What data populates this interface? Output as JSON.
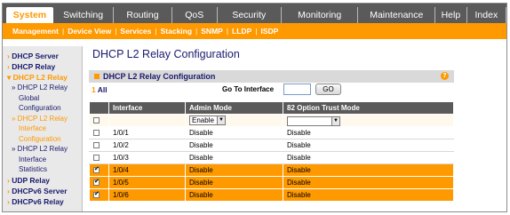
{
  "top_tabs": [
    "System",
    "Switching",
    "Routing",
    "QoS",
    "Security",
    "Monitoring",
    "Maintenance",
    "Help",
    "Index"
  ],
  "sub_nav": [
    "Management",
    "Device View",
    "Services",
    "Stacking",
    "SNMP",
    "LLDP",
    "ISDP"
  ],
  "sidebar": {
    "dhcp_server": "DHCP Server",
    "dhcp_relay": "DHCP Relay",
    "dhcp_l2_relay": "DHCP L2 Relay",
    "sub1": "DHCP L2 Relay",
    "sub1b": "Global",
    "sub1c": "Configuration",
    "sub2": "DHCP L2 Relay",
    "sub2b": "Interface",
    "sub2c": "Configuration",
    "sub3": "DHCP L2 Relay",
    "sub3b": "Interface",
    "sub3c": "Statistics",
    "udp_relay": "UDP Relay",
    "dhcpv6_server": "DHCPv6 Server",
    "dhcpv6_relay": "DHCPv6 Relay"
  },
  "page_title": "DHCP L2 Relay Configuration",
  "panel_title": "DHCP L2 Relay Configuration",
  "filter": {
    "all_num": "1",
    "all_label": "All",
    "goto_label": "Go To Interface",
    "goto_value": "",
    "go_label": "GO"
  },
  "table": {
    "headers": [
      "Interface",
      "Admin Mode",
      "82 Option Trust Mode"
    ],
    "edit_row": {
      "admin_value": "Enable",
      "trust_value": ""
    },
    "rows": [
      {
        "checked": false,
        "iface": "1/0/1",
        "admin": "Disable",
        "trust": "Disable",
        "style": "normal"
      },
      {
        "checked": false,
        "iface": "1/0/2",
        "admin": "Disable",
        "trust": "Disable",
        "style": "normal"
      },
      {
        "checked": false,
        "iface": "1/0/3",
        "admin": "Disable",
        "trust": "Disable",
        "style": "normal"
      },
      {
        "checked": true,
        "iface": "1/0/4",
        "admin": "Disable",
        "trust": "Disable",
        "style": "selected"
      },
      {
        "checked": true,
        "iface": "1/0/5",
        "admin": "Disable",
        "trust": "Disable",
        "style": "selected"
      },
      {
        "checked": true,
        "iface": "1/0/6",
        "admin": "Disable",
        "trust": "Disable",
        "style": "selected"
      }
    ]
  },
  "colors": {
    "accent": "#ff9900",
    "nav": "#5a5a5a",
    "link": "#1a1a6e"
  }
}
